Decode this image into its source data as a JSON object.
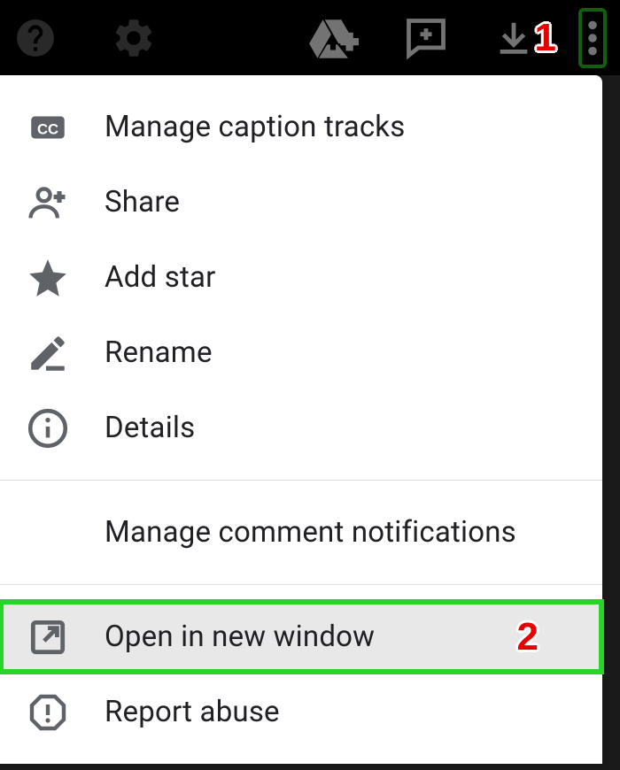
{
  "toolbar": {
    "help_name": "help-icon",
    "settings_name": "settings-gear-icon",
    "drive_name": "add-to-drive-icon",
    "comment_name": "add-comment-icon",
    "download_name": "download-icon",
    "more_name": "more-options-icon"
  },
  "menu": {
    "section1": [
      {
        "id": "captions",
        "label": "Manage caption tracks",
        "icon": "cc-icon"
      },
      {
        "id": "share",
        "label": "Share",
        "icon": "person-add-icon"
      },
      {
        "id": "star",
        "label": "Add star",
        "icon": "star-icon"
      },
      {
        "id": "rename",
        "label": "Rename",
        "icon": "edit-pencil-icon"
      },
      {
        "id": "details",
        "label": "Details",
        "icon": "info-icon"
      }
    ],
    "section2": [
      {
        "id": "comment-notifications",
        "label": "Manage comment notifications",
        "icon": null
      }
    ],
    "section3": [
      {
        "id": "open-new-window",
        "label": "Open in new window",
        "icon": "open-new-window-icon",
        "highlighted": true
      },
      {
        "id": "report-abuse",
        "label": "Report abuse",
        "icon": "report-icon"
      }
    ]
  },
  "annotations": {
    "a1": "1",
    "a2": "2"
  }
}
